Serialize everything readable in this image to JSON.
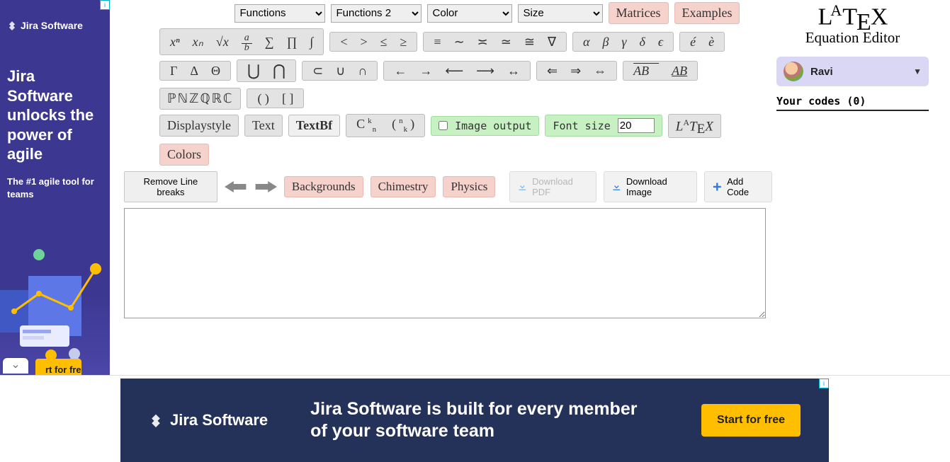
{
  "header": {
    "select_functions": "Functions",
    "select_functions2": "Functions 2",
    "select_color": "Color",
    "select_size": "Size",
    "matrices": "Matrices",
    "examples": "Examples"
  },
  "symrow1": {
    "g1": [
      "xⁿ",
      "xₙ",
      "√x",
      "a/b",
      "∑",
      "∏",
      "∫"
    ],
    "g2": [
      "<",
      ">",
      "≤",
      "≥"
    ],
    "g3": [
      "≡",
      "∼",
      "≍",
      "≃",
      "≅",
      "∇"
    ],
    "g4": [
      "α",
      "β",
      "γ",
      "δ",
      "ϵ"
    ],
    "g5": [
      "é",
      "è"
    ]
  },
  "symrow2": {
    "g1": [
      "Γ",
      "Δ",
      "Θ"
    ],
    "g2": [
      "⋃",
      "⋂"
    ],
    "g3": [
      "⊂",
      "∪",
      "∩"
    ],
    "g4": [
      "←",
      "→",
      "⟵",
      "⟶",
      "↔"
    ],
    "g5": [
      "⇐",
      "⇒",
      "⇔"
    ],
    "g6": [
      "AB⃗",
      "AB"
    ],
    "g7": "ℙℕℤℚℝℂ",
    "g8": [
      "( )",
      "[ ]"
    ]
  },
  "symrow3": {
    "displaystyle": "Displaystyle",
    "text": "Text",
    "textbf": "TextBf",
    "combin": [
      "Cₙᵏ",
      "(ₖⁿ)"
    ],
    "image_output": "Image output",
    "font_size_label": "Font size",
    "font_size_value": "20",
    "latex_label": "LᴬTᴇX",
    "colors": "Colors"
  },
  "toolbar2": {
    "remove_linebreaks": "Remove Line breaks",
    "backgrounds": "Backgrounds",
    "chimestry": "Chimestry",
    "physics": "Physics",
    "download_pdf": "Download PDF",
    "download_image": "Download Image",
    "add_code": "Add Code"
  },
  "editor": {
    "value": ""
  },
  "right": {
    "subtitle": "Equation Editor",
    "user_name": "Ravi",
    "codes_header": "Your codes (0)"
  },
  "side_ad": {
    "brand": "Jira Software",
    "headline": "Jira Software unlocks the power of agile",
    "sub": "The #1 agile tool for teams",
    "cta_cut": "rt for free"
  },
  "bottom_ad": {
    "brand": "Jira Software",
    "headline": "Jira Software is built for every member of your software team",
    "cta": "Start for free"
  },
  "ad_badge": "i"
}
